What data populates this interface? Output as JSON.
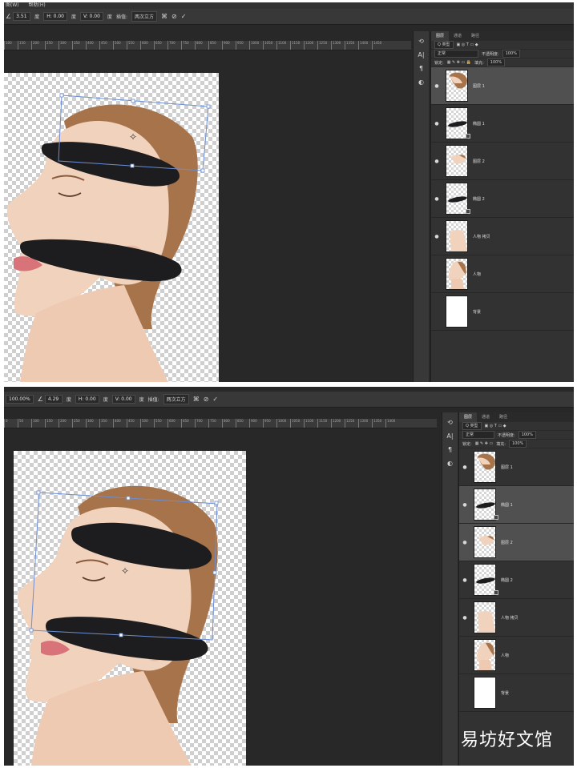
{
  "top": {
    "menu": [
      "图(W)",
      "帮助(H)"
    ],
    "options": {
      "angle": "3.51",
      "h_label": "度",
      "h": "H: 0.00",
      "h_unit": "度",
      "v": "V: 0.00",
      "v_unit": "度",
      "interp_label": "插值:",
      "interp": "两次立方"
    },
    "ruler_ticks": [
      "100",
      "150",
      "200",
      "250",
      "300",
      "350",
      "400",
      "450",
      "500",
      "550",
      "600",
      "650",
      "700",
      "750",
      "800",
      "850",
      "900",
      "950",
      "1000",
      "1050",
      "1100",
      "1150",
      "1200",
      "1250",
      "1300",
      "1350",
      "1400",
      "1450"
    ],
    "tabs": [
      "图层",
      "通道",
      "路径"
    ],
    "kind": "Q 类型",
    "blend": "正常",
    "opacity_label": "不透明度:",
    "opacity": "100%",
    "lock_label": "锁定:",
    "fill_label": "填充:",
    "fill": "100%",
    "layers": [
      {
        "name": "图层 1",
        "thumb": "hair",
        "visible": "●",
        "selected": true
      },
      {
        "name": "椭圆 1",
        "thumb": "band",
        "visible": "●",
        "selected": false
      },
      {
        "name": "图层 2",
        "thumb": "face",
        "visible": "●",
        "selected": false
      },
      {
        "name": "椭圆 2",
        "thumb": "band",
        "visible": "●",
        "selected": false
      },
      {
        "name": "人物 拷贝",
        "thumb": "neck",
        "visible": "●",
        "selected": false
      },
      {
        "name": "人物",
        "thumb": "person",
        "visible": "",
        "selected": false
      },
      {
        "name": "背景",
        "thumb": "white",
        "visible": "",
        "selected": false
      }
    ]
  },
  "bottom": {
    "options": {
      "zoom": "100.00%",
      "angle": "4.29",
      "h_label": "度",
      "h": "H: 0.00",
      "h_unit": "度",
      "v": "V: 0.00",
      "v_unit": "度",
      "interp_label": "插值:",
      "interp": "两次立方"
    },
    "ruler_ticks": [
      "0",
      "50",
      "100",
      "150",
      "200",
      "250",
      "300",
      "350",
      "400",
      "450",
      "500",
      "550",
      "600",
      "650",
      "700",
      "750",
      "800",
      "850",
      "900",
      "950",
      "1000",
      "1050",
      "1100",
      "1150",
      "1200",
      "1250",
      "1300",
      "1350",
      "1400"
    ],
    "tabs": [
      "图层",
      "通道",
      "路径"
    ],
    "kind": "Q 类型",
    "blend": "正常",
    "opacity_label": "不透明度:",
    "opacity": "100%",
    "lock_label": "锁定:",
    "fill_label": "填充:",
    "fill": "100%",
    "layers": [
      {
        "name": "图层 1",
        "thumb": "hair",
        "visible": "●",
        "selected": false
      },
      {
        "name": "椭圆 1",
        "thumb": "band",
        "visible": "●",
        "selected": true
      },
      {
        "name": "图层 2",
        "thumb": "face",
        "visible": "●",
        "selected": true
      },
      {
        "name": "椭圆 2",
        "thumb": "band",
        "visible": "●",
        "selected": false
      },
      {
        "name": "人物 拷贝",
        "thumb": "neck",
        "visible": "●",
        "selected": false
      },
      {
        "name": "人物",
        "thumb": "person",
        "visible": "",
        "selected": false
      },
      {
        "name": "背景",
        "thumb": "white",
        "visible": "",
        "selected": false
      }
    ]
  },
  "watermark": "易坊好文馆",
  "colors": {
    "app_bg": "#282828",
    "panel": "#323232",
    "band": "#1d1d1f",
    "skin": "#f1d2bd",
    "hair": "#a6734b",
    "lips": "#d9737a"
  }
}
